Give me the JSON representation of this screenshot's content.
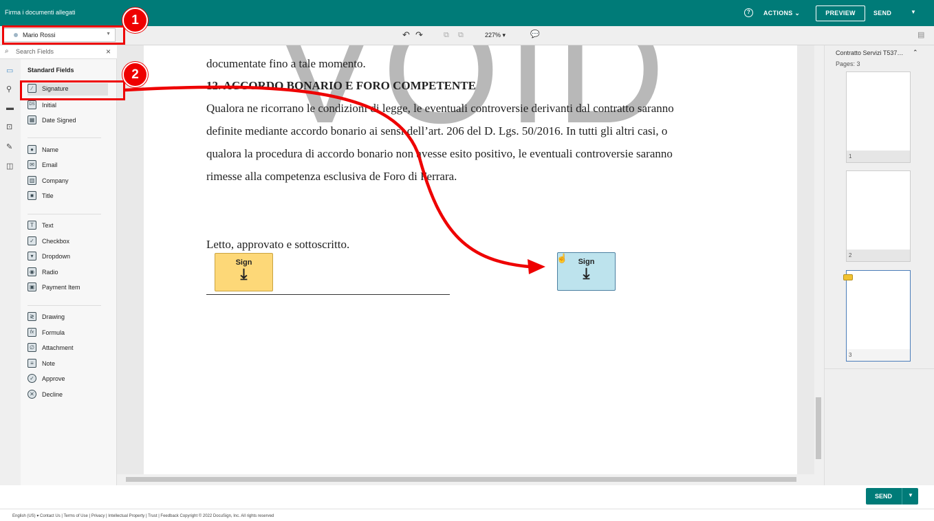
{
  "header": {
    "title": "Firma i documenti allegati",
    "help_icon": "?",
    "actions_label": "ACTIONS",
    "preview_label": "PREVIEW",
    "send_label": "SEND",
    "send_caret": "▼",
    "accent_color": "#007b78"
  },
  "toolbar": {
    "recipient": "Mario Rossi",
    "recipient_caret": "▼",
    "undo_icon": "↶",
    "redo_icon": "↷",
    "copy_icon": "⧉",
    "paste_icon": "⧉",
    "zoom": "227% ▾",
    "comment_icon": "💬",
    "pages_icon": "▤"
  },
  "search": {
    "placeholder": "Search Fields",
    "icon": "⌕",
    "clear": "×"
  },
  "fields": {
    "section_title": "Standard Fields",
    "group1": [
      {
        "label": "Signature",
        "icon": "∕"
      },
      {
        "label": "Initial",
        "icon": "DS"
      },
      {
        "label": "Date Signed",
        "icon": "▦"
      }
    ],
    "group2": [
      {
        "label": "Name",
        "icon": "●"
      },
      {
        "label": "Email",
        "icon": "✉"
      },
      {
        "label": "Company",
        "icon": "▥"
      },
      {
        "label": "Title",
        "icon": "■"
      }
    ],
    "group3": [
      {
        "label": "Text",
        "icon": "T"
      },
      {
        "label": "Checkbox",
        "icon": "✓"
      },
      {
        "label": "Dropdown",
        "icon": "▾"
      },
      {
        "label": "Radio",
        "icon": "◉"
      },
      {
        "label": "Payment Item",
        "icon": "▣"
      }
    ],
    "group4": [
      {
        "label": "Drawing",
        "icon": "≷"
      },
      {
        "label": "Formula",
        "icon": "fx"
      },
      {
        "label": "Attachment",
        "icon": "∅"
      },
      {
        "label": "Note",
        "icon": "≡"
      },
      {
        "label": "Approve",
        "icon": "✓"
      },
      {
        "label": "Decline",
        "icon": "✕"
      }
    ]
  },
  "document": {
    "watermark": "VOID",
    "line1": "documentate fino a tale momento.",
    "heading": "12. ACCORDO BONARIO E FORO COMPETENTE",
    "para1": "Qualora ne ricorrano le condizioni di legge, le eventuali controversie derivanti dal contratto saranno",
    "para2": "definite mediante accordo bonario ai sensi dell’art. 206 del D. Lgs. 50/2016. In tutti gli altri casi, o",
    "para3": "qualora la procedura di accordo bonario non avesse esito positivo, le eventuali controversie saranno",
    "para4": "rimesse alla competenza esclusiva de Foro di Ferrara.",
    "closing": "Letto, approvato e sottoscritto.",
    "sign_tab_1": {
      "label": "Sign",
      "arrow": "⤓",
      "color": "#fdd878"
    },
    "sign_tab_2": {
      "label": "Sign",
      "arrow": "⤓",
      "color": "#bde3ed"
    }
  },
  "thumbnails": {
    "doc_name": "Contratto Servizi T537…",
    "pages_label": "Pages: 3",
    "collapse_icon": "⌃",
    "pages": [
      {
        "num": "1"
      },
      {
        "num": "2"
      },
      {
        "num": "3"
      }
    ]
  },
  "footer": {
    "send_label": "SEND",
    "send_caret": "▼",
    "links": "English (US) ▾   Contact Us  |  Terms of Use  |  Privacy  |  Intellectual Property  |  Trust  |  Feedback     Copyright © 2022 DocuSign, Inc. All rights reserved"
  },
  "annotations": {
    "badge1": "1",
    "badge2": "2",
    "color": "#e00000"
  }
}
